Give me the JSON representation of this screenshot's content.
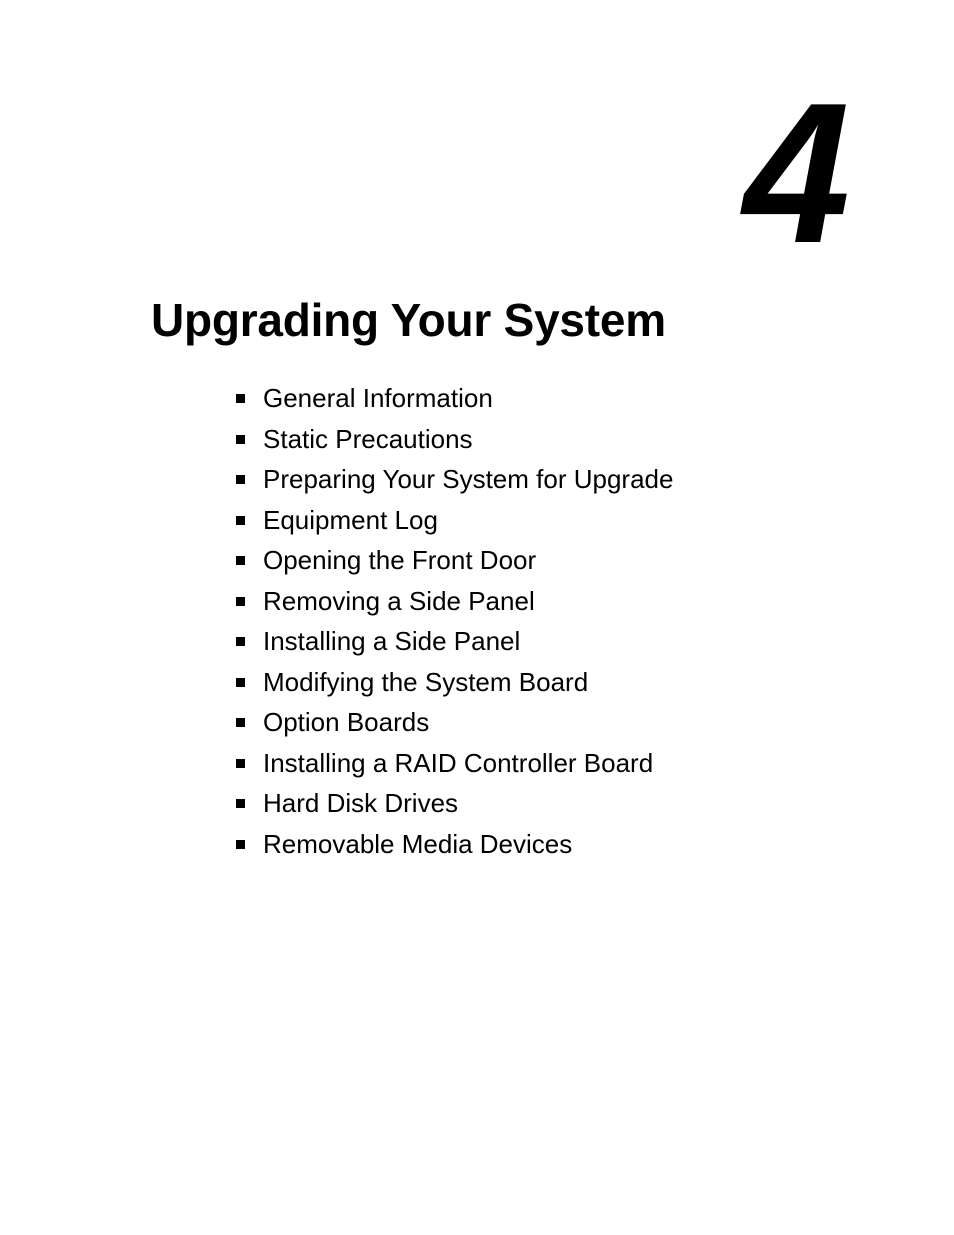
{
  "page": {
    "background_color": "#ffffff",
    "text_color": "#000000"
  },
  "chapter": {
    "number": "4",
    "title": "Upgrading Your System"
  },
  "bullet": {
    "icon_name": "square-bullet-icon",
    "color": "#000000"
  },
  "topics": [
    {
      "label": "General Information"
    },
    {
      "label": "Static Precautions"
    },
    {
      "label": "Preparing Your System for Upgrade"
    },
    {
      "label": "Equipment Log"
    },
    {
      "label": "Opening the Front Door"
    },
    {
      "label": "Removing a Side Panel"
    },
    {
      "label": "Installing a Side Panel"
    },
    {
      "label": "Modifying the System Board"
    },
    {
      "label": "Option Boards"
    },
    {
      "label": "Installing a RAID Controller Board"
    },
    {
      "label": "Hard Disk Drives"
    },
    {
      "label": "Removable Media Devices"
    }
  ]
}
